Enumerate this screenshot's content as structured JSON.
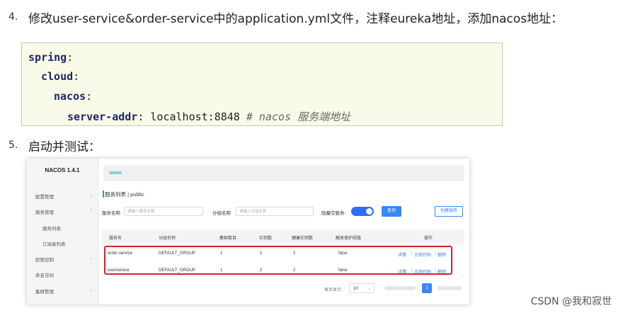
{
  "step4": {
    "number": "4.",
    "text": "修改user-service&order-service中的application.yml文件，注释eureka地址，添加nacos地址："
  },
  "code": {
    "spring": "spring",
    "cloud": "cloud",
    "nacos": "nacos",
    "server_addr_key": "server-addr",
    "server_addr_value": "localhost:8848",
    "comment": "# nacos 服务端地址"
  },
  "step5": {
    "number": "5.",
    "text": "启动并测试："
  },
  "nacos": {
    "logo": "NACOS 1.4.1",
    "menu": [
      {
        "label": "配置管理",
        "chevron": "⌄"
      },
      {
        "label": "服务管理",
        "chevron": "⌃"
      },
      {
        "label": "服务列表",
        "sub": true
      },
      {
        "label": "订阅者列表",
        "sub": true
      },
      {
        "label": "权限控制",
        "chevron": "⌄"
      },
      {
        "label": "命名空间"
      },
      {
        "label": "集群管理",
        "chevron": "⌄"
      }
    ],
    "breadcrumb": "服务列表  |  public",
    "filters": {
      "service_name_label": "服务名称",
      "service_name_placeholder": "请输入服务名称",
      "group_name_label": "分组名称",
      "group_name_placeholder": "请输入分组名称",
      "hide_empty_label": "隐藏空服务:",
      "query_button": "查询",
      "create_button": "创建服务"
    },
    "table": {
      "headers": [
        "服务名",
        "分组名称",
        "集群数目",
        "实例数",
        "健康实例数",
        "触发保护阈值",
        "操作"
      ],
      "rows": [
        [
          "order-service",
          "DEFAULT_GROUP",
          "1",
          "1",
          "1",
          "false"
        ],
        [
          "userservice",
          "DEFAULT_GROUP",
          "1",
          "2",
          "2",
          "false"
        ]
      ],
      "actions": [
        "详情",
        "示例代码",
        "删除"
      ]
    },
    "pagination": {
      "label": "每页显示:",
      "size": "10",
      "chevron": "⌄",
      "current": "1"
    }
  },
  "watermark": "CSDN @我和寂世"
}
